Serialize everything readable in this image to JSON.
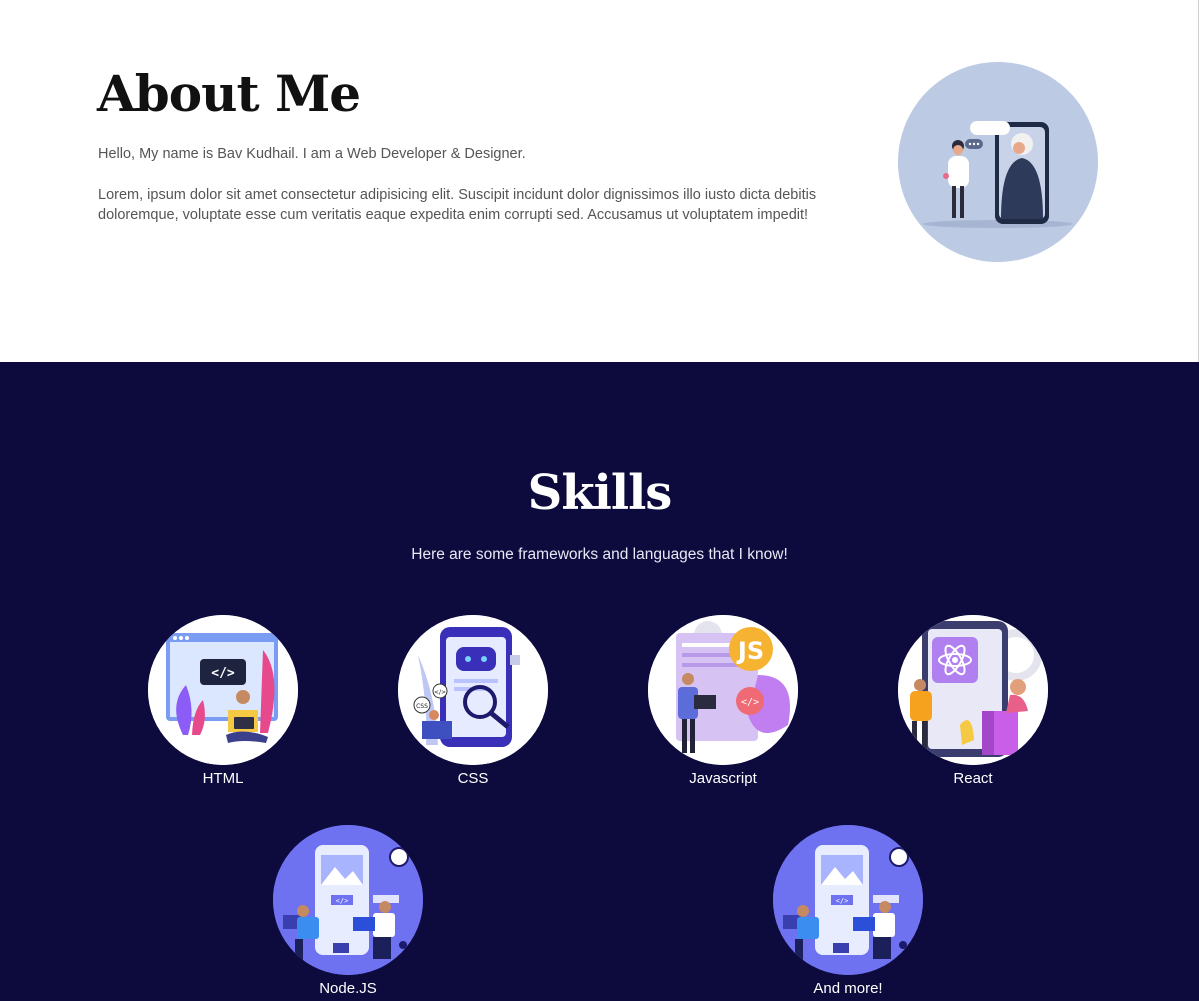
{
  "about": {
    "title": "About Me",
    "intro": "Hello, My name is Bav Kudhail. I am a Web Developer & Designer.",
    "body": "Lorem, ipsum dolor sit amet consectetur adipisicing elit. Suscipit incidunt dolor dignissimos illo iusto dicta debitis doloremque, voluptate esse cum veritatis eaque expedita enim corrupti sed. Accusamus ut voluptatem impedit!"
  },
  "skills": {
    "title": "Skills",
    "subtitle": "Here are some frameworks and languages that I know!",
    "items": [
      {
        "label": "HTML",
        "icon": "html-illustration-icon"
      },
      {
        "label": "CSS",
        "icon": "css-illustration-icon"
      },
      {
        "label": "Javascript",
        "icon": "javascript-illustration-icon"
      },
      {
        "label": "React",
        "icon": "react-illustration-icon"
      },
      {
        "label": "Node.JS",
        "icon": "nodejs-illustration-icon"
      },
      {
        "label": "And more!",
        "icon": "more-illustration-icon"
      }
    ]
  },
  "colors": {
    "dark_bg": "#0d0b3e",
    "about_circle": "#bccae4",
    "node_circle": "#6e72f0"
  }
}
